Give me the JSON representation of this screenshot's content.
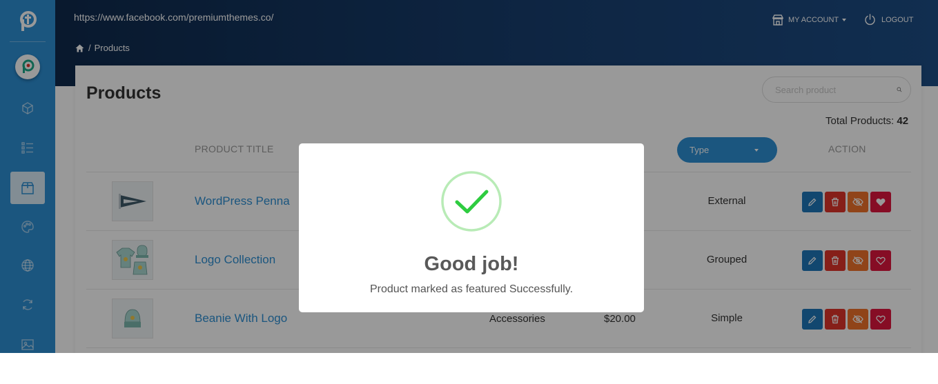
{
  "header": {
    "url": "https://www.facebook.com/premiumthemes.co/",
    "breadcrumb": "Products",
    "account_label": "MY ACCOUNT",
    "logout_label": "LOGOUT"
  },
  "sidebar": {
    "items": [
      {
        "icon": "cube-icon",
        "active": false
      },
      {
        "icon": "list-icon",
        "active": false
      },
      {
        "icon": "box-icon",
        "active": true
      },
      {
        "icon": "palette-icon",
        "active": false
      },
      {
        "icon": "globe-icon",
        "active": false
      },
      {
        "icon": "sync-icon",
        "active": false
      },
      {
        "icon": "image-icon",
        "active": false
      }
    ]
  },
  "page": {
    "title": "Products",
    "search_placeholder": "Search product",
    "total_label": "Total Products:",
    "total_count": "42"
  },
  "table": {
    "headers": {
      "product_title": "PRODUCT TITLE",
      "type_filter": "Type",
      "action": "ACTION"
    },
    "rows": [
      {
        "title": "WordPress Penna",
        "category": "",
        "price": "",
        "type": "External",
        "featured": true
      },
      {
        "title": "Logo Collection",
        "category": "",
        "price": "",
        "type": "Grouped",
        "featured": false
      },
      {
        "title": "Beanie With Logo",
        "category": "Accessories",
        "price": "$20.00",
        "type": "Simple",
        "featured": false
      }
    ]
  },
  "modal": {
    "title": "Good job!",
    "message": "Product marked as featured Successfully."
  },
  "colors": {
    "sidebar": "#2d8fd4",
    "header_dark": "#0f2a4d",
    "accent": "#2d8fd4",
    "edit": "#1f77b9",
    "delete": "#e0342b",
    "hide": "#f0722a",
    "featured": "#e0163f",
    "success": "#2ecc40"
  }
}
